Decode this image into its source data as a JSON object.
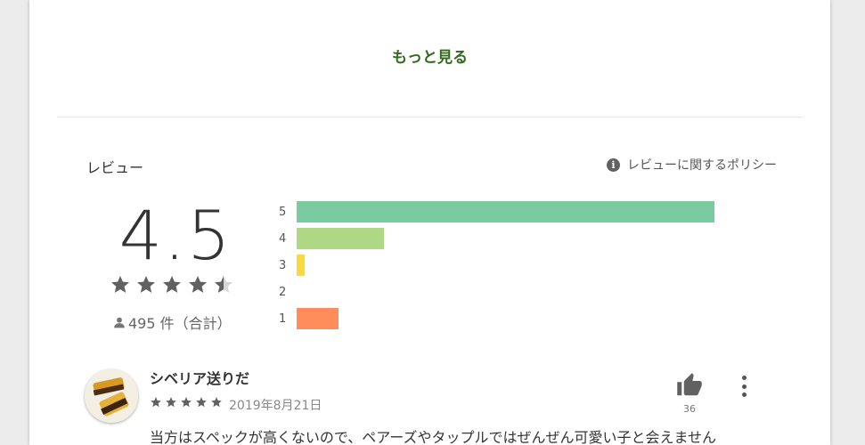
{
  "more_link": "もっと見る",
  "reviews_section": {
    "title": "レビュー",
    "policy_label": "レビューに関するポリシー",
    "average": "4.5",
    "rating_stars": 4.5,
    "total_count": "495 件（合計）",
    "histogram": [
      {
        "label": "5",
        "fraction": 1.0,
        "color": "#7bcba0"
      },
      {
        "label": "4",
        "fraction": 0.21,
        "color": "#afd885"
      },
      {
        "label": "3",
        "fraction": 0.02,
        "color": "#ffd93b"
      },
      {
        "label": "2",
        "fraction": 0.0,
        "color": "#ffb334"
      },
      {
        "label": "1",
        "fraction": 0.1,
        "color": "#ff8c5a"
      }
    ]
  },
  "review": {
    "author": "シベリア送りだ",
    "stars": 5,
    "date": "2019年8月21日",
    "helpful_count": "36",
    "text": "当方はスペックが高くないので、ペアーズやタップルではぜんぜん可愛い子と会えません"
  },
  "colors": {
    "accent_green": "#33691e",
    "star_gray": "#616161"
  }
}
